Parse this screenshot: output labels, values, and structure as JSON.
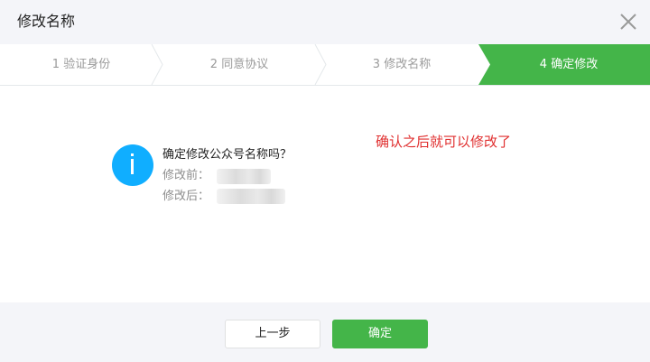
{
  "dialog": {
    "title": "修改名称",
    "close_icon": "close-icon"
  },
  "steps": [
    {
      "label": "1 验证身份",
      "active": false
    },
    {
      "label": "2 同意协议",
      "active": false
    },
    {
      "label": "3 修改名称",
      "active": false
    },
    {
      "label": "4 确定修改",
      "active": true
    }
  ],
  "content": {
    "icon": "info-icon",
    "question": "确定修改公众号名称吗？",
    "before_label": "修改前：",
    "after_label": "修改后：",
    "note": "确认之后就可以修改了"
  },
  "footer": {
    "prev_label": "上一步",
    "confirm_label": "确定"
  },
  "colors": {
    "accent": "#44b549",
    "info": "#10aeff",
    "note": "#e02f2f",
    "header_bg": "#f4f5f9"
  }
}
